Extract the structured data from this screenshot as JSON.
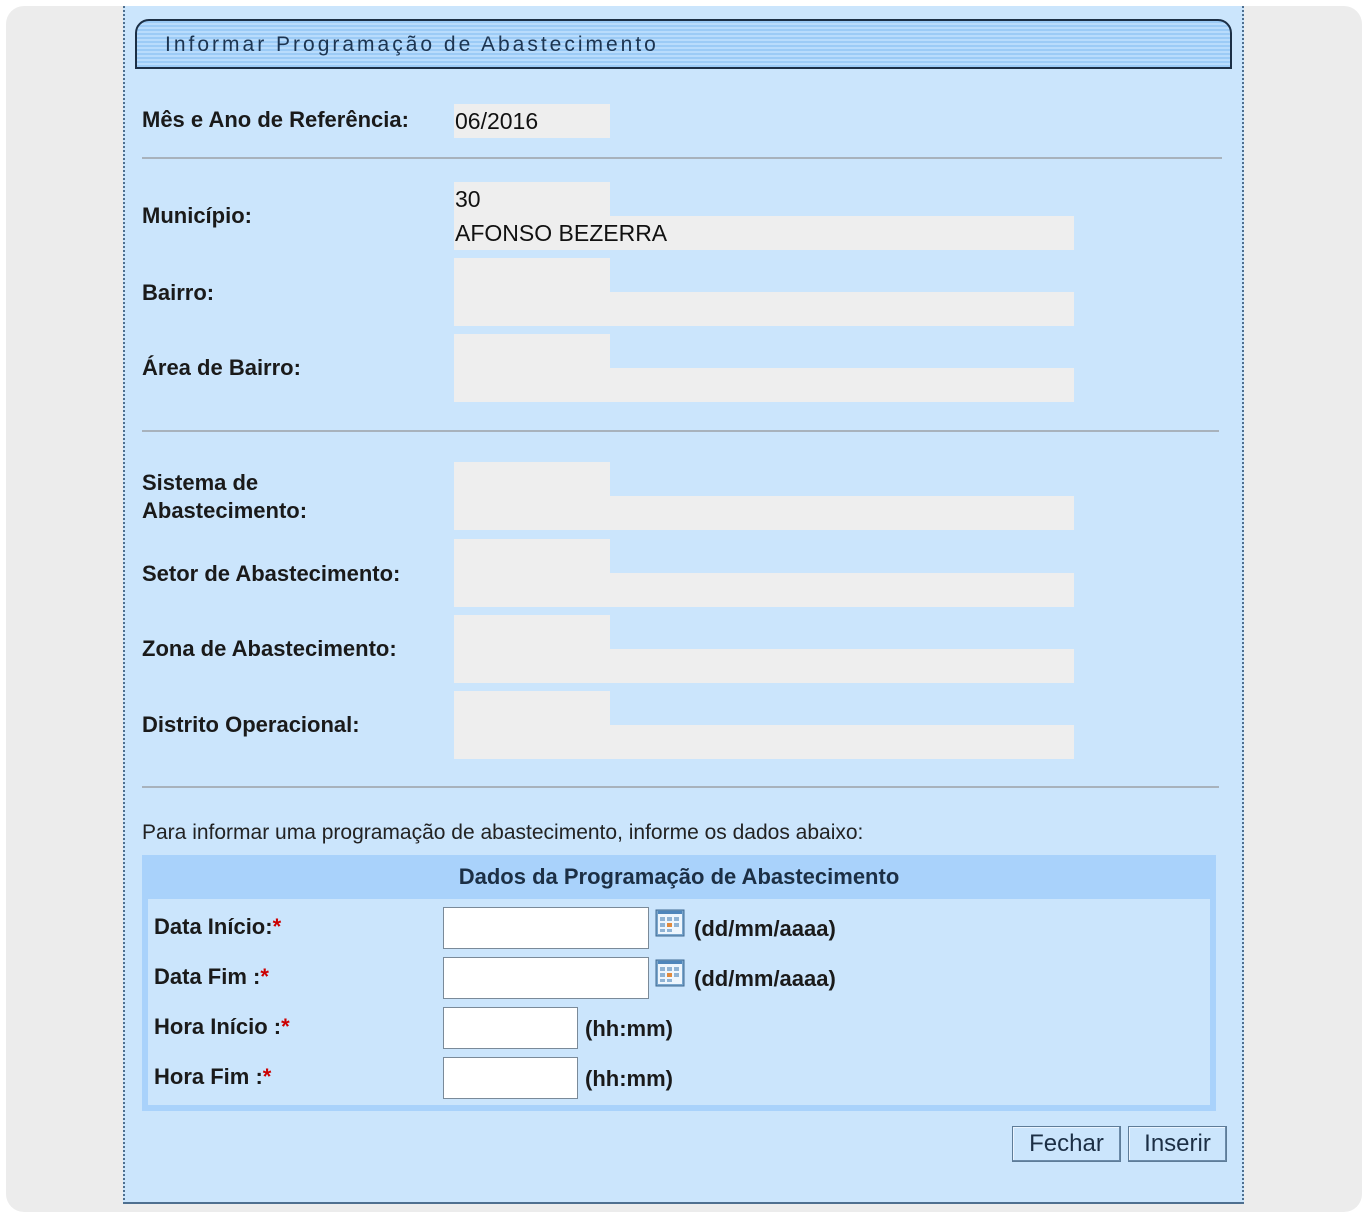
{
  "title": "Informar Programação de Abastecimento",
  "referencia": {
    "label": "Mês e Ano de Referência:",
    "value": "06/2016"
  },
  "municipio": {
    "label": "Município:",
    "code": "30",
    "name": "AFONSO BEZERRA"
  },
  "bairro": {
    "label": "Bairro:"
  },
  "area_bairro": {
    "label": "Área de Bairro:"
  },
  "sistema": {
    "label_line1": "Sistema de",
    "label_line2": "Abastecimento:"
  },
  "setor": {
    "label": "Setor de Abastecimento:"
  },
  "zona": {
    "label": "Zona de Abastecimento:"
  },
  "distrito": {
    "label": "Distrito Operacional:"
  },
  "note": "Para informar uma programação de abastecimento, informe os dados abaixo:",
  "dados": {
    "header": "Dados da Programação de Abastecimento",
    "data_inicio": {
      "label": "Data Início:",
      "required": "*",
      "value": "",
      "format": "(dd/mm/aaaa)"
    },
    "data_fim": {
      "label": "Data Fim :",
      "required": "*",
      "value": "",
      "format": "(dd/mm/aaaa)"
    },
    "hora_inicio": {
      "label": "Hora Início :",
      "required": "*",
      "value": "",
      "format": "(hh:mm)"
    },
    "hora_fim": {
      "label": "Hora Fim :",
      "required": "*",
      "value": "",
      "format": "(hh:mm)"
    }
  },
  "buttons": {
    "fechar": "Fechar",
    "inserir": "Inserir"
  },
  "colors": {
    "panel_bg": "#cbe5fc",
    "header_bg": "#a9d2fb",
    "required": "#cc0000",
    "readonly_bg": "#eeeeee"
  }
}
